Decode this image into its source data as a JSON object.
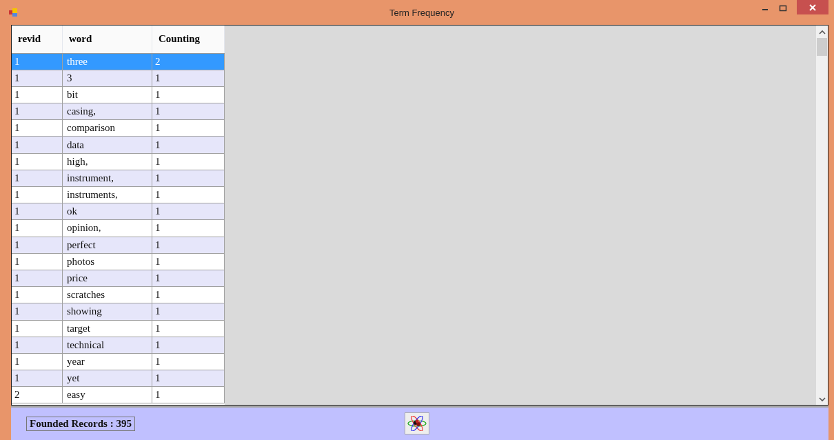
{
  "window": {
    "title": "Term Frequency"
  },
  "table": {
    "columns": [
      "revid",
      "word",
      "Counting"
    ],
    "rows": [
      {
        "cells": [
          "1",
          "three",
          "2"
        ],
        "selected": true
      },
      {
        "cells": [
          "1",
          "3",
          "1"
        ],
        "selected": false
      },
      {
        "cells": [
          "1",
          "bit",
          "1"
        ],
        "selected": false
      },
      {
        "cells": [
          "1",
          "casing,",
          "1"
        ],
        "selected": false
      },
      {
        "cells": [
          "1",
          "comparison",
          "1"
        ],
        "selected": false
      },
      {
        "cells": [
          "1",
          "data",
          "1"
        ],
        "selected": false
      },
      {
        "cells": [
          "1",
          "high,",
          "1"
        ],
        "selected": false
      },
      {
        "cells": [
          "1",
          "instrument,",
          "1"
        ],
        "selected": false
      },
      {
        "cells": [
          "1",
          "instruments,",
          "1"
        ],
        "selected": false
      },
      {
        "cells": [
          "1",
          "ok",
          "1"
        ],
        "selected": false
      },
      {
        "cells": [
          "1",
          "opinion,",
          "1"
        ],
        "selected": false
      },
      {
        "cells": [
          "1",
          "perfect",
          "1"
        ],
        "selected": false
      },
      {
        "cells": [
          "1",
          "photos",
          "1"
        ],
        "selected": false
      },
      {
        "cells": [
          "1",
          "price",
          "1"
        ],
        "selected": false
      },
      {
        "cells": [
          "1",
          "scratches",
          "1"
        ],
        "selected": false
      },
      {
        "cells": [
          "1",
          "showing",
          "1"
        ],
        "selected": false
      },
      {
        "cells": [
          "1",
          "target",
          "1"
        ],
        "selected": false
      },
      {
        "cells": [
          "1",
          "technical",
          "1"
        ],
        "selected": false
      },
      {
        "cells": [
          "1",
          "year",
          "1"
        ],
        "selected": false
      },
      {
        "cells": [
          "1",
          "yet",
          "1"
        ],
        "selected": false
      },
      {
        "cells": [
          "2",
          "easy",
          "1"
        ],
        "selected": false
      }
    ]
  },
  "status": {
    "records": "Founded Records : 395"
  }
}
